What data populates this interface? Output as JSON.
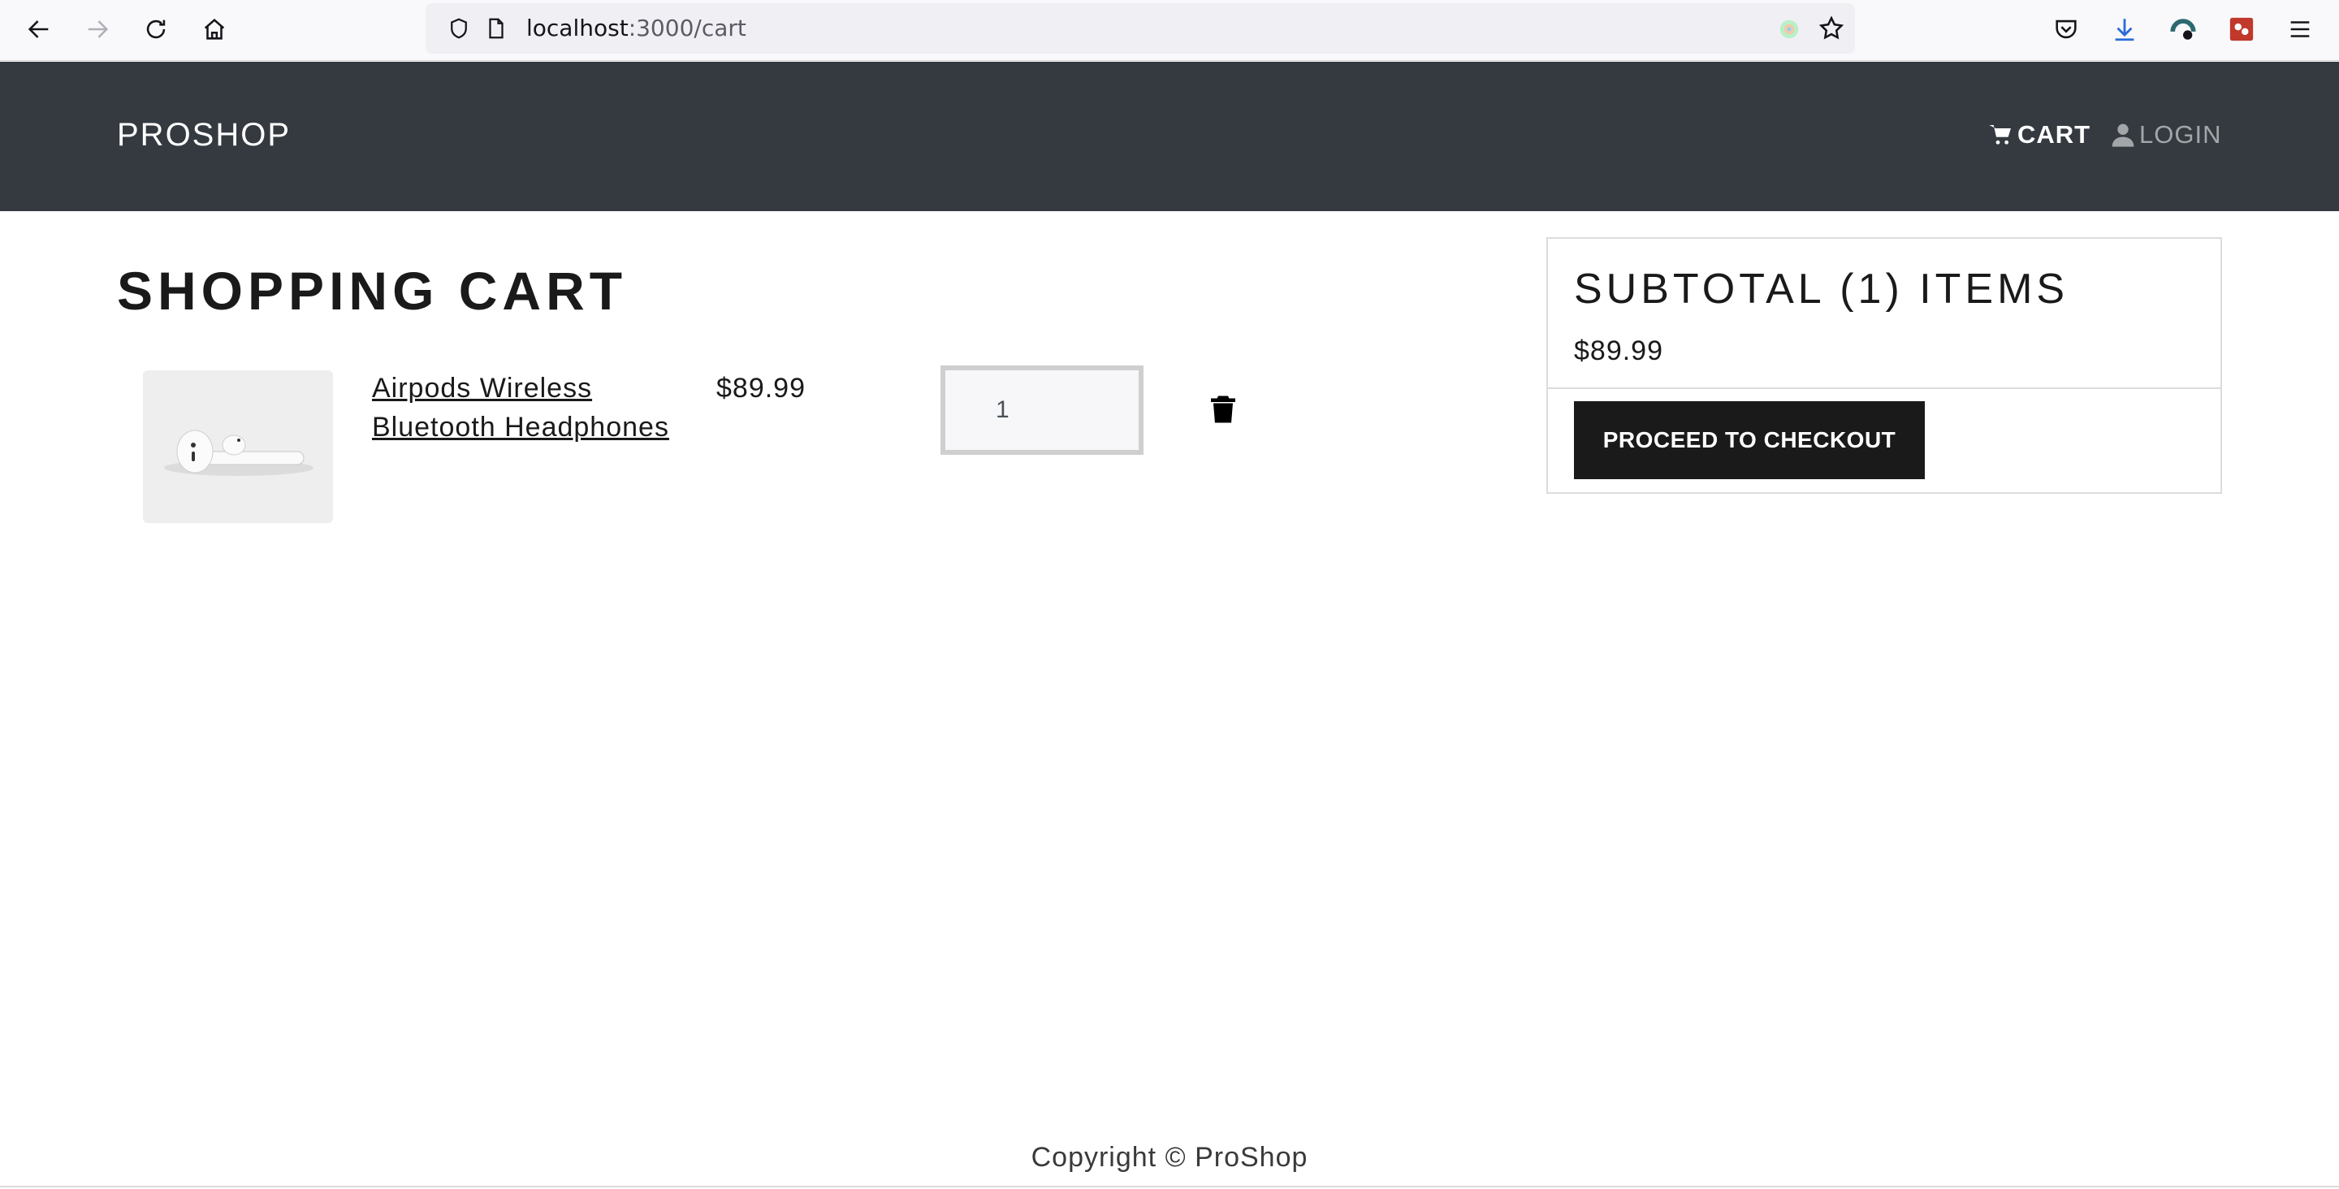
{
  "browser": {
    "url_host": "localhost",
    "url_path": ":3000/cart",
    "icons": [
      "back-icon",
      "forward-icon",
      "reload-icon",
      "home-icon",
      "shield-icon",
      "page-icon",
      "extension-icon",
      "bookmark-star-icon",
      "pocket-icon",
      "download-icon",
      "vpn-icon",
      "extension-red-icon",
      "menu-icon"
    ]
  },
  "header": {
    "brand": "PROSHOP",
    "cart_label": "CART",
    "login_label": "LOGIN"
  },
  "main": {
    "title": "SHOPPING CART",
    "items": [
      {
        "name": "Airpods Wireless Bluetooth Headphones",
        "price": "$89.99",
        "quantity": "1"
      }
    ]
  },
  "summary": {
    "title": "SUBTOTAL (1) ITEMS",
    "total": "$89.99",
    "checkout_label": "PROCEED TO CHECKOUT"
  },
  "footer": {
    "text": "Copyright © ProShop"
  },
  "colors": {
    "header_bg": "#343a40",
    "button_bg": "#1a1a1a"
  }
}
